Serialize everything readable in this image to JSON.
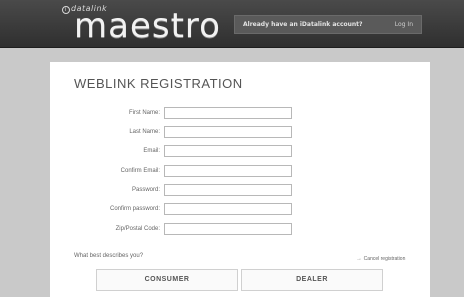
{
  "header": {
    "logo_small": "datalink",
    "logo_circle": "i",
    "logo_main": "maestro",
    "account_question": "Already have an iDatalink account?",
    "login_label": "Log In"
  },
  "form": {
    "title": "WEBLINK REGISTRATION",
    "fields": [
      {
        "label": "First Name:",
        "value": ""
      },
      {
        "label": "Last Name:",
        "value": ""
      },
      {
        "label": "Email:",
        "value": ""
      },
      {
        "label": "Confirm Email:",
        "value": ""
      },
      {
        "label": "Password:",
        "value": ""
      },
      {
        "label": "Confirm password:",
        "value": ""
      },
      {
        "label": "Zip/Postal Code:",
        "value": ""
      }
    ],
    "question": "What best describes you?",
    "cancel_label": "Cancel registration",
    "consumer_label": "CONSUMER",
    "dealer_label": "DEALER"
  },
  "colors": {
    "header_bg": "#3a3a3a",
    "page_bg": "#c9c9c9",
    "panel_bg": "#ffffff"
  }
}
